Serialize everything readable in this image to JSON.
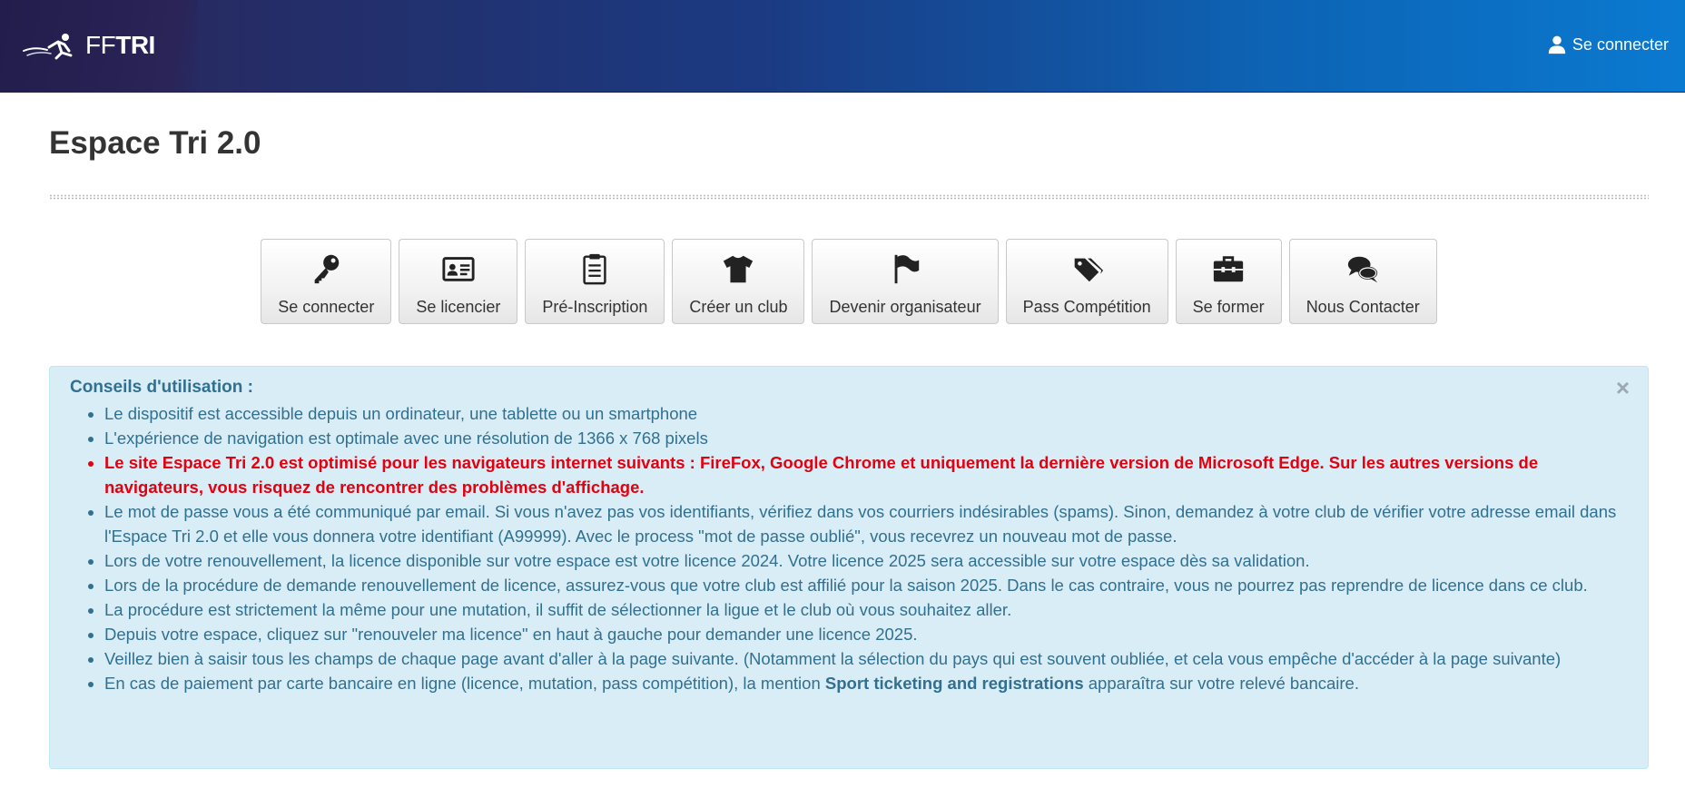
{
  "header": {
    "logo_ff": "FF",
    "logo_tri": "TRI",
    "login_label": "Se connecter"
  },
  "page": {
    "title": "Espace Tri 2.0"
  },
  "tiles": [
    {
      "label": "Se connecter",
      "icon": "key-icon"
    },
    {
      "label": "Se licencier",
      "icon": "id-card-icon"
    },
    {
      "label": "Pré-Inscription",
      "icon": "clipboard-icon"
    },
    {
      "label": "Créer un club",
      "icon": "tshirt-icon"
    },
    {
      "label": "Devenir organisateur",
      "icon": "flag-icon"
    },
    {
      "label": "Pass Compétition",
      "icon": "tags-icon"
    },
    {
      "label": "Se former",
      "icon": "briefcase-icon"
    },
    {
      "label": "Nous Contacter",
      "icon": "chat-bubbles-icon"
    }
  ],
  "alert": {
    "close": "×",
    "heading": "Conseils d'utilisation :",
    "items": [
      "Le dispositif est accessible depuis un ordinateur, une tablette ou un smartphone",
      "L'expérience de navigation est optimale avec une résolution de 1366 x 768 pixels",
      "Le site Espace Tri 2.0 est optimisé pour les navigateurs internet suivants : FireFox, Google Chrome et uniquement la dernière version de Microsoft Edge. Sur les autres versions de navigateurs, vous risquez de rencontrer des problèmes d'affichage.",
      "Le mot de passe vous a été communiqué par email. Si vous n'avez pas vos identifiants, vérifiez dans vos courriers indésirables (spams). Sinon, demandez à votre club de vérifier votre adresse email dans l'Espace Tri 2.0 et elle vous donnera votre identifiant (A99999). Avec le process \"mot de passe oublié\", vous recevrez un nouveau mot de passe.",
      "Lors de votre renouvellement, la licence disponible sur votre espace est votre licence 2024. Votre licence 2025 sera accessible sur votre espace dès sa validation.",
      "Lors de la procédure de demande renouvellement de licence, assurez-vous que votre club est affilié pour la saison 2025. Dans le cas contraire, vous ne pourrez pas reprendre de licence dans ce club.",
      "La procédure est strictement la même pour une mutation, il suffit de sélectionner la ligue et le club où vous souhaitez aller.",
      "Depuis votre espace, cliquez sur \"renouveler ma licence\" en haut à gauche pour demander une licence 2025.",
      "Veillez bien à saisir tous les champs de chaque page avant d'aller à la page suivante. (Notamment la sélection du pays qui est souvent oubliée, et cela vous empêche d'accéder à la page suivante)"
    ],
    "last_item": {
      "before": "En cas de paiement par carte bancaire en ligne (licence, mutation, pass compétition), la mention ",
      "bold": "Sport ticketing and registrations",
      "after": " apparaîtra sur votre relevé bancaire."
    }
  },
  "colors": {
    "alert_bg": "#d9edf7",
    "alert_text": "#31708f",
    "warning_text": "#e3000f",
    "header_dark": "#231f4e",
    "header_light": "#0a7ad0"
  }
}
